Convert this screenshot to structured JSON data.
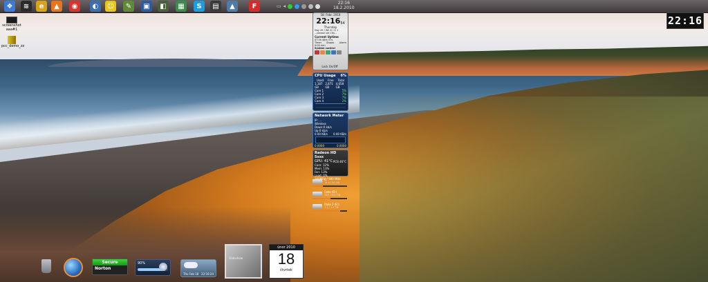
{
  "taskbar": {
    "icons": [
      {
        "name": "windows-logo-icon",
        "glyph": "❖",
        "bg": "#3a7bd5"
      },
      {
        "name": "wifi-icon",
        "glyph": "≋",
        "bg": "#2b2b2b"
      },
      {
        "name": "e-app-icon",
        "glyph": "e",
        "bg": "#d8a316"
      },
      {
        "name": "vlc-icon",
        "glyph": "▲",
        "bg": "#e8751a"
      },
      {
        "name": "chrome-icon",
        "glyph": "◉",
        "bg": "#d9342b"
      },
      {
        "name": "app-icon-6",
        "glyph": "◐",
        "bg": "#3d6fb0"
      },
      {
        "name": "smiley-app-icon",
        "glyph": "☺",
        "bg": "#e8c51a"
      },
      {
        "name": "tools-icon",
        "glyph": "✎",
        "bg": "#5e8a3a"
      },
      {
        "name": "monitor-icon",
        "glyph": "▣",
        "bg": "#2d5c9e"
      },
      {
        "name": "app-icon-10",
        "glyph": "◧",
        "bg": "#4a5f3c"
      },
      {
        "name": "chart-app-icon",
        "glyph": "▦",
        "bg": "#3d8a4a"
      },
      {
        "name": "skype-icon",
        "glyph": "S",
        "bg": "#1e9ce0"
      },
      {
        "name": "terminal-icon",
        "glyph": "▤",
        "bg": "#3a3a3a"
      },
      {
        "name": "landscape-icon",
        "glyph": "▲",
        "bg": "#4e7ba8"
      },
      {
        "name": "f-app-icon",
        "glyph": "F",
        "bg": "#d52b2b"
      }
    ],
    "tray_time": "22:16",
    "tray_date": "18.2.2010"
  },
  "desktop_icons": [
    {
      "name": "screenshot-file-icon",
      "label": "screenshot\naaa#1"
    },
    {
      "name": "archive-file-icon",
      "label": "pcc_demo_zz"
    }
  ],
  "clock_gadget": {
    "date": "18. Febr. 2010",
    "time": "22:16",
    "seconds": "54",
    "weekday": "Thursday",
    "info_line": "Day 49 / Wk 8 / Q 1",
    "sub_line": "...please set City...",
    "uptime_label": "Current Uptime",
    "uptime_value": "0T 0h 46m 57s",
    "alarm_labels": [
      "Timer",
      "Stopw.",
      "Alarm"
    ],
    "alarm_value": "0:00 min",
    "system_control": "System control",
    "lock_label": "Lock On/Off"
  },
  "cpu_gadget": {
    "title": "CPU Usage",
    "percent": "6%",
    "columns": [
      "Used",
      "Free",
      "Total"
    ],
    "values": [
      "1,187 GB",
      "2,871 GB",
      "4,058 GB"
    ],
    "cores": [
      {
        "label": "Core 1",
        "value": "5%"
      },
      {
        "label": "Core 2",
        "value": "7%"
      },
      {
        "label": "Core 3",
        "value": "7%"
      },
      {
        "label": "Core 4",
        "value": "2%"
      }
    ]
  },
  "net_gadget": {
    "title": "Network Meter",
    "lines": [
      "IP: ...",
      "Wireless",
      "Down:0 kb/s",
      "Up:0 kb/s"
    ],
    "down": "0.00 KB/s",
    "up": "0.00 KB/s",
    "bottom_left": "0.0000",
    "bottom_right": "0.0000"
  },
  "gpu_gadget": {
    "title": "Radeon HD 5xxx",
    "temp_label": "GPU: 41°C",
    "pcb": "PCB 46°C",
    "rows": [
      "Core: 12%",
      "Mem: 13%",
      "Fan: 13%",
      "Load: 0%"
    ],
    "footer": "300MHz / 900 MHz 0.00V"
  },
  "drives": [
    {
      "name": "drive-c",
      "label": "C:",
      "stat": "14.6 / 50 GB",
      "fill": 0.3
    },
    {
      "name": "drive-d",
      "label": "Data (D:)",
      "stat": "260 / 500 GB",
      "fill": 0.52
    },
    {
      "name": "drive-e",
      "label": "Data 2 (E:)",
      "stat": "1.2 / 1.5 TB",
      "fill": 0.8
    }
  ],
  "norton": {
    "status": "Secure",
    "brand": "Norton"
  },
  "volume": {
    "label": "90%"
  },
  "weather": {
    "line1": "Thu Feb 18",
    "line2": "22:16:24"
  },
  "photo": {
    "label": "Slideshow"
  },
  "calendar": {
    "month": "únor 2010",
    "day": "18",
    "weekday": "čtvrtek"
  },
  "big_clock": {
    "time": "22:16"
  },
  "colors": {
    "accent": "#3a6aa8",
    "secure": "#1eb81e",
    "gpu_bg": "#1a1a1a"
  }
}
